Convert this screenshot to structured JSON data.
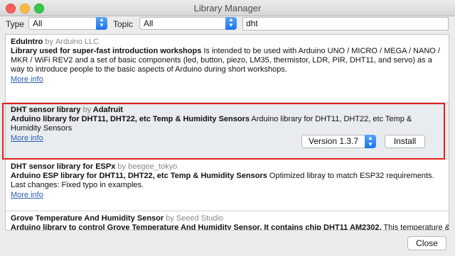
{
  "window": {
    "title": "Library Manager"
  },
  "filters": {
    "type_label": "Type",
    "type_value": "All",
    "topic_label": "Topic",
    "topic_value": "All",
    "search_value": "dht"
  },
  "libraries": [
    {
      "name": "EduIntro",
      "by": "by",
      "author": "Arduino LLC",
      "sentence": "Library used for super-fast introduction workshops",
      "paragraph": " Is intended to be used with Arduino UNO / MICRO / MEGA / NANO / MKR / WiFi REV2 and a set of basic components (led, button, piezo, LM35, thermistor, LDR, PIR, DHT11, and servo) as a way to introduce people to the basic aspects of Arduino during short workshops.",
      "more": "More info"
    },
    {
      "name": "DHT sensor library",
      "by": "by",
      "author": "Adafruit",
      "sentence": "Arduino library for DHT11, DHT22, etc Temp & Humidity Sensors",
      "paragraph": " Arduino library for DHT11, DHT22, etc Temp & Humidity Sensors",
      "more": "More info",
      "version": "Version 1.3.7",
      "install": "Install"
    },
    {
      "name": "DHT sensor library for ESPx",
      "by": "by",
      "author": "beegee_tokyo",
      "sentence": "Arduino ESP library for DHT11, DHT22, etc Temp & Humidity Sensors",
      "paragraph": " Optimized libray to match ESP32 requirements. Last changes: Fixed typo in examples.",
      "more": "More info"
    },
    {
      "name": "Grove Temperature And Humidity Sensor",
      "by": "by",
      "author": "Seeed Studio",
      "sentence": "Arduino library to control Grove Temperature And Humidity Sensor. It contains chip DHT11 AM2302.",
      "paragraph": " This temperature & humidity"
    }
  ],
  "footer": {
    "close_label": "Close"
  },
  "colors": {
    "highlight": "#e02020",
    "link": "#2a5db0",
    "selected_row": "#e8ecef"
  }
}
